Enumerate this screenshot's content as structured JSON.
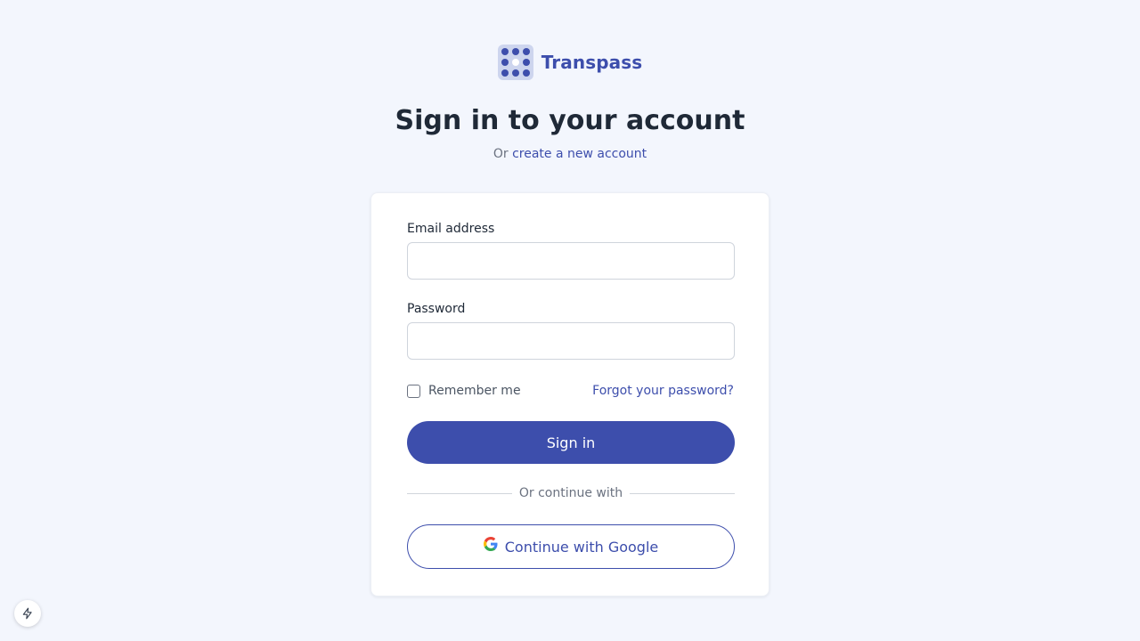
{
  "brand": {
    "name": "Transpass",
    "logo_icon": "grid-dots-logo",
    "color": "#3d4eac"
  },
  "header": {
    "title": "Sign in to your account",
    "subtitle_prefix": "Or",
    "create_account_link": "create a new account"
  },
  "form": {
    "email": {
      "label": "Email address",
      "value": "",
      "placeholder": ""
    },
    "password": {
      "label": "Password",
      "value": "",
      "placeholder": ""
    },
    "remember_me": {
      "label": "Remember me",
      "checked": false
    },
    "forgot_link": "Forgot your password?",
    "submit_label": "Sign in",
    "divider_text": "Or continue with",
    "google_button_label": "Continue with Google"
  },
  "devtools": {
    "icon": "lightning-bolt-icon"
  },
  "colors": {
    "background": "#f3f6fd",
    "accent": "#3d4eac",
    "card": "#ffffff",
    "muted_text": "#6b7280"
  }
}
